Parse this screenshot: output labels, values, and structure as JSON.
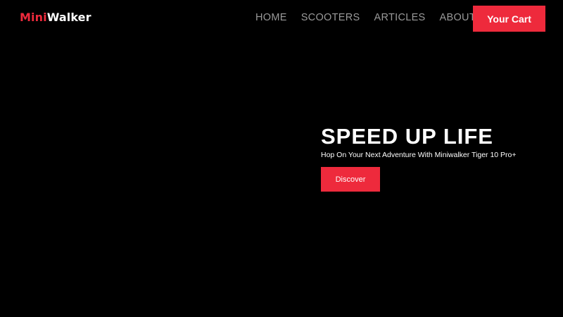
{
  "header": {
    "logo": {
      "accent_text": "Mini",
      "rest_text": "Walker"
    },
    "nav": [
      {
        "label": "HOME"
      },
      {
        "label": "SCOOTERS"
      },
      {
        "label": "ARTICLES"
      },
      {
        "label": "ABOUT"
      }
    ],
    "cart_label": "Your Cart"
  },
  "hero": {
    "title": "SPEED UP LIFE",
    "subtitle": "Hop On Your Next Adventure With Miniwalker Tiger 10 Pro+",
    "cta_label": "Discover"
  },
  "colors": {
    "background": "#000000",
    "accent": "#ee2a3c",
    "nav_text": "#9a9a9a",
    "text": "#ffffff"
  }
}
